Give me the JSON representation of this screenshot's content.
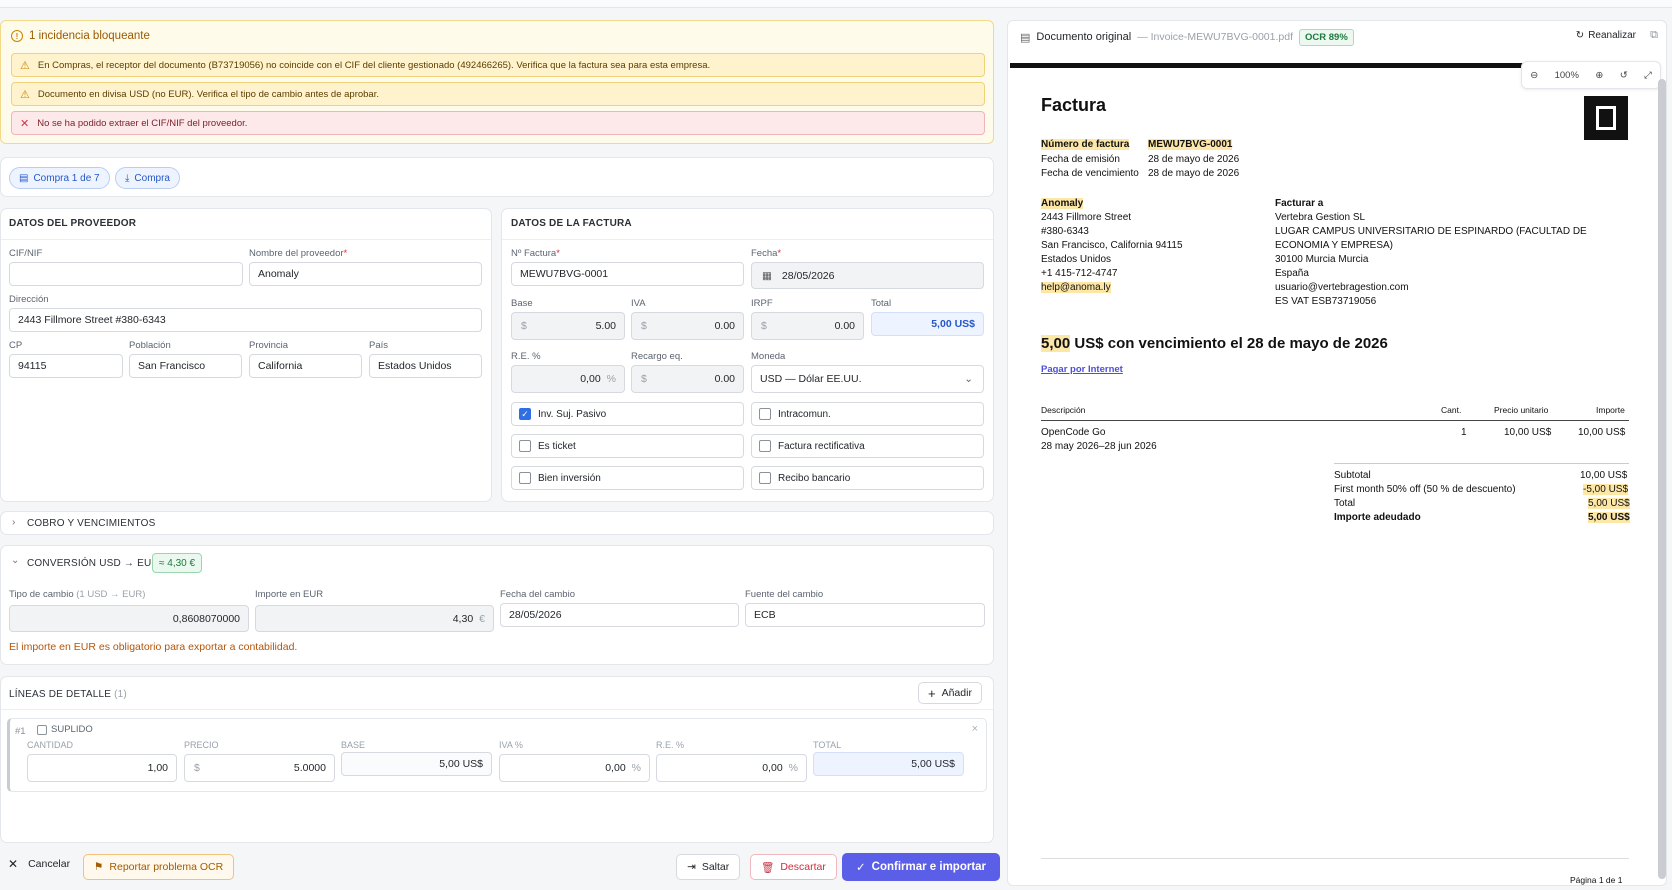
{
  "alerts": {
    "title": "1 incidencia bloqueante",
    "items": [
      {
        "type": "warn",
        "text": "En Compras, el receptor del documento (B73719056) no coincide con el CIF del cliente gestionado (492466265). Verifica que la factura sea para esta empresa."
      },
      {
        "type": "warn",
        "text": "Documento en divisa USD (no EUR). Verifica el tipo de cambio antes de aprobar."
      },
      {
        "type": "err",
        "text": "No se ha podido extraer el CIF/NIF del proveedor."
      }
    ]
  },
  "pills": {
    "counter": "Compra 1 de 7",
    "type": "Compra"
  },
  "supplier": {
    "title": "DATOS DEL PROVEEDOR",
    "cif_label": "CIF/NIF",
    "cif_value": "",
    "name_label": "Nombre del proveedor",
    "name_value": "Anomaly",
    "address_label": "Dirección",
    "address_value": "2443 Fillmore Street #380-6343",
    "cp_label": "CP",
    "cp_value": "94115",
    "city_label": "Población",
    "city_value": "San Francisco",
    "province_label": "Provincia",
    "province_value": "California",
    "country_label": "País",
    "country_value": "Estados Unidos"
  },
  "invoice": {
    "title": "DATOS DE LA FACTURA",
    "number_label": "Nº Factura",
    "number_value": "MEWU7BVG-0001",
    "date_label": "Fecha",
    "date_value": "28/05/2026",
    "base_label": "Base",
    "base_value": "5.00",
    "iva_label": "IVA",
    "iva_value": "0.00",
    "irpf_label": "IRPF",
    "irpf_value": "0.00",
    "total_label": "Total",
    "total_value": "5,00 US$",
    "re_label": "R.E. %",
    "re_value": "0,00",
    "recargo_label": "Recargo eq.",
    "recargo_value": "0.00",
    "currency_label": "Moneda",
    "currency_value": "USD — Dólar EE.UU.",
    "currency_symbol": "$",
    "percent_symbol": "%",
    "checks": [
      {
        "label": "Inv. Suj. Pasivo",
        "checked": true
      },
      {
        "label": "Intracomun.",
        "checked": false
      },
      {
        "label": "Es ticket",
        "checked": false
      },
      {
        "label": "Factura rectificativa",
        "checked": false
      },
      {
        "label": "Bien inversión",
        "checked": false
      },
      {
        "label": "Recibo bancario",
        "checked": false
      }
    ]
  },
  "cobro": {
    "title": "COBRO Y VENCIMIENTOS"
  },
  "conversion": {
    "title": "CONVERSIÓN USD → EUR",
    "badge": "≈ 4,30 €",
    "rate_label": "Tipo de cambio",
    "rate_hint": "(1 USD → EUR)",
    "rate_value": "0,8608070000",
    "eur_label": "Importe en EUR",
    "eur_value": "4,30",
    "eur_symbol": "€",
    "date_label": "Fecha del cambio",
    "date_value": "28/05/2026",
    "source_label": "Fuente del cambio",
    "source_value": "ECB",
    "error": "El importe en EUR es obligatorio para exportar a contabilidad."
  },
  "lines": {
    "title": "LÍNEAS DE DETALLE",
    "count": "(1)",
    "add": "Añadir",
    "row": {
      "index": "#1",
      "suplido": "SUPLIDO",
      "qty_label": "CANTIDAD",
      "qty": "1,00",
      "price_label": "PRECIO",
      "price": "5.0000",
      "base_label": "BASE",
      "base": "5,00 US$",
      "iva_label": "IVA %",
      "iva": "0,00",
      "re_label": "R.E. %",
      "re": "0,00",
      "total_label": "TOTAL",
      "total": "5,00 US$"
    }
  },
  "footer": {
    "cancel": "Cancelar",
    "report": "Reportar problema OCR",
    "skip": "Saltar",
    "discard": "Descartar",
    "confirm": "Confirmar e importar"
  },
  "viewer": {
    "title": "Documento original",
    "filename": "— Invoice-MEWU7BVG-0001.pdf",
    "ocr": "OCR 89%",
    "reanalyze": "Reanalizar",
    "zoom": "100%",
    "doc": {
      "heading": "Factura",
      "meta": [
        {
          "k": "Número de factura",
          "v": "MEWU7BVG-0001"
        },
        {
          "k": "Fecha de emisión",
          "v": "28 de mayo de 2026"
        },
        {
          "k": "Fecha de vencimiento",
          "v": "28 de mayo de 2026"
        }
      ],
      "from": [
        "Anomaly",
        "2443 Fillmore Street",
        "#380-6343",
        "San Francisco, California 94115",
        "Estados Unidos",
        "+1 415-712-4747",
        "help@anoma.ly"
      ],
      "to_title": "Facturar a",
      "to": [
        "Vertebra Gestion SL",
        "LUGAR CAMPUS UNIVERSITARIO DE ESPINARDO (FACULTAD DE",
        "ECONOMIA Y EMPRESA)",
        "30100 Murcia Murcia",
        "España",
        "usuario@vertebragestion.com",
        "ES VAT  ESB73719056"
      ],
      "due_amount": "5,00",
      "due_text": "US$ con vencimiento el 28 de mayo de 2026",
      "pay_link": "Pagar por Internet",
      "cols": {
        "desc": "Descripción",
        "qty": "Cant.",
        "unit": "Precio unitario",
        "amount": "Importe"
      },
      "item": {
        "desc": "OpenCode Go",
        "period": "28 may 2026–28 jun 2026",
        "qty": "1",
        "unit": "10,00 US$",
        "amount": "10,00 US$"
      },
      "totals": [
        {
          "k": "Subtotal",
          "v": "10,00 US$"
        },
        {
          "k": "First month 50% off (50 % de descuento)",
          "v": "-5,00 US$"
        },
        {
          "k": "Total",
          "v": "5,00 US$"
        },
        {
          "k": "Importe adeudado",
          "v": "5,00 US$"
        }
      ],
      "page": "Página 1 de 1"
    }
  }
}
